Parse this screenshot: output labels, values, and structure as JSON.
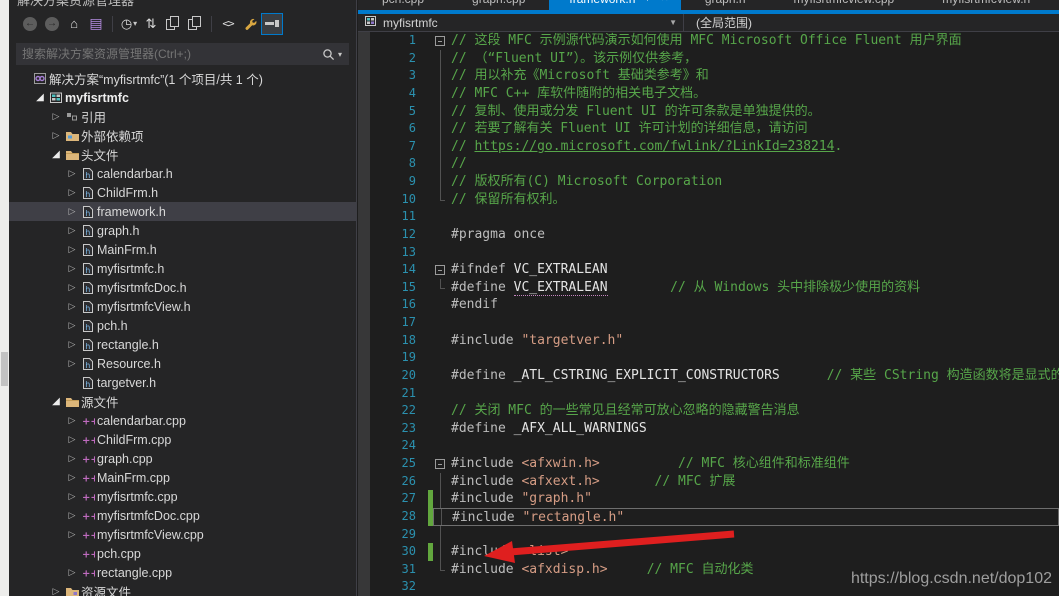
{
  "explorer": {
    "title": "解决方案资源管理器",
    "header_icons": [
      {
        "name": "chevron-down-icon",
        "glyph": "▾"
      },
      {
        "name": "pin-icon",
        "glyph": "⊤"
      },
      {
        "name": "close-icon",
        "glyph": "✕"
      }
    ],
    "toolbar": [
      {
        "name": "back-button",
        "kind": "circle",
        "glyph": "←"
      },
      {
        "name": "forward-button",
        "kind": "circle",
        "glyph": "→"
      },
      {
        "name": "home-button",
        "kind": "plain",
        "glyph": "⌂"
      },
      {
        "name": "switch-views-button",
        "kind": "purple",
        "glyph": "▤"
      },
      {
        "name": "separator"
      },
      {
        "name": "pending-changes-button",
        "kind": "plain",
        "glyph": "◷",
        "caret": true
      },
      {
        "name": "sync-with-active-document-button",
        "kind": "plain",
        "glyph": "⇅"
      },
      {
        "name": "nest-files-button",
        "kind": "docs"
      },
      {
        "name": "copy-button",
        "kind": "docs"
      },
      {
        "name": "separator"
      },
      {
        "name": "view-code-button",
        "kind": "code2",
        "glyph": "<>"
      },
      {
        "name": "properties-button",
        "kind": "wrench"
      },
      {
        "name": "preview-selected-items-button",
        "kind": "preview",
        "selected": true
      }
    ],
    "search_placeholder": "搜索解决方案资源管理器(Ctrl+;)",
    "tree": [
      {
        "label": "解决方案“myfisrtmfc”(1 个项目/共 1 个)",
        "icon": "solution",
        "indent": 0,
        "arrow": "none"
      },
      {
        "label": "myfisrtmfc",
        "icon": "project",
        "indent": 1,
        "arrow": "expanded",
        "bold": true
      },
      {
        "label": "引用",
        "icon": "references",
        "indent": 2,
        "arrow": "collapsed"
      },
      {
        "label": "外部依赖项",
        "icon": "ext-deps",
        "indent": 2,
        "arrow": "collapsed"
      },
      {
        "label": "头文件",
        "icon": "folder",
        "indent": 2,
        "arrow": "expanded"
      },
      {
        "label": "calendarbar.h",
        "icon": "hfile",
        "indent": 3,
        "arrow": "collapsed"
      },
      {
        "label": "ChildFrm.h",
        "icon": "hfile",
        "indent": 3,
        "arrow": "collapsed"
      },
      {
        "label": "framework.h",
        "icon": "hfile",
        "indent": 3,
        "arrow": "collapsed",
        "selected": true
      },
      {
        "label": "graph.h",
        "icon": "hfile",
        "indent": 3,
        "arrow": "collapsed"
      },
      {
        "label": "MainFrm.h",
        "icon": "hfile",
        "indent": 3,
        "arrow": "collapsed"
      },
      {
        "label": "myfisrtmfc.h",
        "icon": "hfile",
        "indent": 3,
        "arrow": "collapsed"
      },
      {
        "label": "myfisrtmfcDoc.h",
        "icon": "hfile",
        "indent": 3,
        "arrow": "collapsed"
      },
      {
        "label": "myfisrtmfcView.h",
        "icon": "hfile",
        "indent": 3,
        "arrow": "collapsed"
      },
      {
        "label": "pch.h",
        "icon": "hfile",
        "indent": 3,
        "arrow": "collapsed"
      },
      {
        "label": "rectangle.h",
        "icon": "hfile",
        "indent": 3,
        "arrow": "collapsed"
      },
      {
        "label": "Resource.h",
        "icon": "hfile",
        "indent": 3,
        "arrow": "collapsed"
      },
      {
        "label": "targetver.h",
        "icon": "hfile",
        "indent": 3,
        "arrow": "none"
      },
      {
        "label": "源文件",
        "icon": "folder",
        "indent": 2,
        "arrow": "expanded"
      },
      {
        "label": "calendarbar.cpp",
        "icon": "cppfile",
        "indent": 3,
        "arrow": "collapsed"
      },
      {
        "label": "ChildFrm.cpp",
        "icon": "cppfile",
        "indent": 3,
        "arrow": "collapsed"
      },
      {
        "label": "graph.cpp",
        "icon": "cppfile",
        "indent": 3,
        "arrow": "collapsed"
      },
      {
        "label": "MainFrm.cpp",
        "icon": "cppfile",
        "indent": 3,
        "arrow": "collapsed"
      },
      {
        "label": "myfisrtmfc.cpp",
        "icon": "cppfile",
        "indent": 3,
        "arrow": "collapsed"
      },
      {
        "label": "myfisrtmfcDoc.cpp",
        "icon": "cppfile",
        "indent": 3,
        "arrow": "collapsed"
      },
      {
        "label": "myfisrtmfcView.cpp",
        "icon": "cppfile",
        "indent": 3,
        "arrow": "collapsed"
      },
      {
        "label": "pch.cpp",
        "icon": "cppfile",
        "indent": 3,
        "arrow": "none"
      },
      {
        "label": "rectangle.cpp",
        "icon": "cppfile",
        "indent": 3,
        "arrow": "collapsed"
      },
      {
        "label": "资源文件",
        "icon": "res-folder",
        "indent": 2,
        "arrow": "collapsed"
      }
    ]
  },
  "tabs": [
    {
      "label": "pch.cpp",
      "active": false
    },
    {
      "label": "graph.cpp",
      "active": false
    },
    {
      "label": "framework.h",
      "active": true
    },
    {
      "label": "graph.h",
      "active": false
    },
    {
      "label": "myfisrtmfcview.cpp",
      "active": false
    },
    {
      "label": "myfisrtmfcview.h",
      "active": false
    }
  ],
  "navbar": {
    "project": "myfisrtmfc",
    "scope": "(全局范围)"
  },
  "editor": {
    "lines": [
      {
        "n": 1,
        "fold": "box",
        "toks": [
          [
            "com",
            "// 这段 MFC 示例源代码演示如何使用 MFC Microsoft Office Fluent 用户界面"
          ]
        ]
      },
      {
        "n": 2,
        "fold": "line",
        "toks": [
          [
            "com",
            "// （“Fluent UI”）。该示例仅供参考，"
          ]
        ]
      },
      {
        "n": 3,
        "fold": "line",
        "toks": [
          [
            "com",
            "// 用以补充《Microsoft 基础类参考》和"
          ]
        ]
      },
      {
        "n": 4,
        "fold": "line",
        "toks": [
          [
            "com",
            "// MFC C++ 库软件随附的相关电子文档。"
          ]
        ]
      },
      {
        "n": 5,
        "fold": "line",
        "toks": [
          [
            "com",
            "// 复制、使用或分发 Fluent UI 的许可条款是单独提供的。"
          ]
        ]
      },
      {
        "n": 6,
        "fold": "line",
        "toks": [
          [
            "com",
            "// 若要了解有关 Fluent UI 许可计划的详细信息，请访问"
          ]
        ]
      },
      {
        "n": 7,
        "fold": "line",
        "toks": [
          [
            "com",
            "// "
          ],
          [
            "url",
            "https://go.microsoft.com/fwlink/?LinkId=238214"
          ],
          [
            "com",
            "."
          ]
        ]
      },
      {
        "n": 8,
        "fold": "line",
        "toks": [
          [
            "com",
            "//"
          ]
        ]
      },
      {
        "n": 9,
        "fold": "line",
        "toks": [
          [
            "com",
            "// 版权所有(C) Microsoft Corporation"
          ]
        ]
      },
      {
        "n": 10,
        "fold": "end",
        "toks": [
          [
            "com",
            "// 保留所有权利。"
          ]
        ]
      },
      {
        "n": 11,
        "fold": "",
        "toks": []
      },
      {
        "n": 12,
        "fold": "",
        "toks": [
          [
            "pp",
            "#pragma once"
          ]
        ]
      },
      {
        "n": 13,
        "fold": "",
        "toks": []
      },
      {
        "n": 14,
        "fold": "box",
        "toks": [
          [
            "pp",
            "#ifndef "
          ],
          [
            "macro",
            "VC_EXTRALEAN"
          ]
        ]
      },
      {
        "n": 15,
        "fold": "end",
        "toks": [
          [
            "pp",
            "#define "
          ],
          [
            "macrou",
            "VC_EXTRALEAN"
          ],
          [
            "plain",
            "        "
          ],
          [
            "com",
            "// 从 Windows 头中排除极少使用的资料"
          ]
        ]
      },
      {
        "n": 16,
        "fold": "",
        "toks": [
          [
            "pp",
            "#endif"
          ]
        ]
      },
      {
        "n": 17,
        "fold": "",
        "toks": []
      },
      {
        "n": 18,
        "fold": "",
        "toks": [
          [
            "pp",
            "#include "
          ],
          [
            "str",
            "\"targetver.h\""
          ]
        ]
      },
      {
        "n": 19,
        "fold": "",
        "toks": []
      },
      {
        "n": 20,
        "fold": "",
        "toks": [
          [
            "pp",
            "#define "
          ],
          [
            "macro",
            "_ATL_CSTRING_EXPLICIT_CONSTRUCTORS"
          ],
          [
            "plain",
            "      "
          ],
          [
            "com",
            "// 某些 CString 构造函数将是显式的"
          ]
        ]
      },
      {
        "n": 21,
        "fold": "",
        "toks": []
      },
      {
        "n": 22,
        "fold": "",
        "toks": [
          [
            "com",
            "// 关闭 MFC 的一些常见且经常可放心忽略的隐藏警告消息"
          ]
        ]
      },
      {
        "n": 23,
        "fold": "",
        "toks": [
          [
            "pp",
            "#define "
          ],
          [
            "macro",
            "_AFX_ALL_WARNINGS"
          ]
        ]
      },
      {
        "n": 24,
        "fold": "",
        "toks": []
      },
      {
        "n": 25,
        "fold": "box",
        "toks": [
          [
            "pp",
            "#include "
          ],
          [
            "str",
            "<afxwin.h>"
          ],
          [
            "plain",
            "          "
          ],
          [
            "com",
            "// MFC 核心组件和标准组件"
          ]
        ]
      },
      {
        "n": 26,
        "fold": "line",
        "toks": [
          [
            "pp",
            "#include "
          ],
          [
            "str",
            "<afxext.h>"
          ],
          [
            "plain",
            "       "
          ],
          [
            "com",
            "// MFC 扩展"
          ]
        ]
      },
      {
        "n": 27,
        "fold": "line",
        "chg": true,
        "toks": [
          [
            "pp",
            "#include "
          ],
          [
            "str",
            "\"graph.h\""
          ]
        ]
      },
      {
        "n": 28,
        "fold": "line",
        "chg": true,
        "caret": true,
        "toks": [
          [
            "pp",
            "#include "
          ],
          [
            "str",
            "\"rectangle.h\""
          ]
        ]
      },
      {
        "n": 29,
        "fold": "line",
        "toks": []
      },
      {
        "n": 30,
        "fold": "line",
        "chg": true,
        "toks": [
          [
            "pp",
            "#include "
          ],
          [
            "str",
            "<list>"
          ]
        ]
      },
      {
        "n": 31,
        "fold": "end",
        "toks": [
          [
            "pp",
            "#include "
          ],
          [
            "str",
            "<afxdisp.h>"
          ],
          [
            "plain",
            "     "
          ],
          [
            "com",
            "// MFC 自动化类"
          ]
        ]
      },
      {
        "n": 32,
        "fold": "",
        "toks": []
      }
    ]
  },
  "annotation": {
    "arrow_color": "#df1f1f",
    "points_at_line": 30
  },
  "watermark": "https://blog.csdn.net/dop102",
  "colors": {
    "accent": "#007acc",
    "selection": "#3f3f46",
    "comment": "#57a64a",
    "string": "#d69d85",
    "line_number": "#2b91af",
    "change_bar": "#62a73e",
    "panel_bg": "#252526",
    "editor_bg": "#1e1e1e"
  }
}
